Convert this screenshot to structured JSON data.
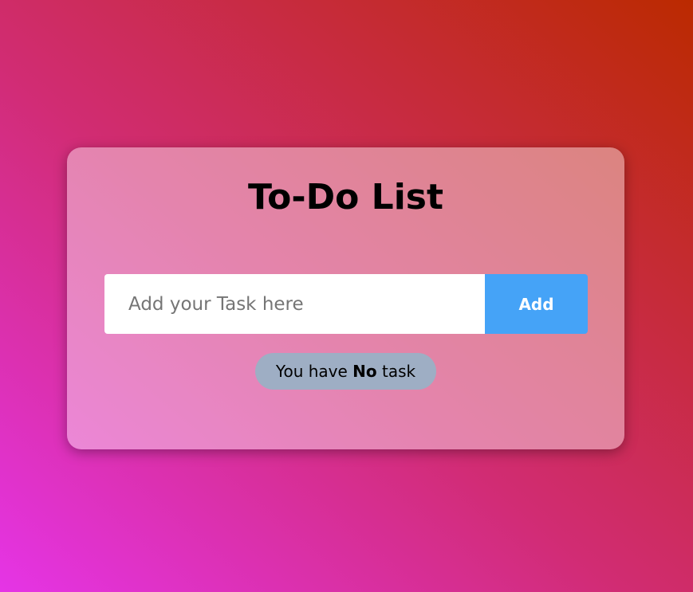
{
  "app": {
    "title": "To-Do List"
  },
  "task_form": {
    "input_value": "",
    "input_placeholder": "Add your Task here",
    "add_label": "Add"
  },
  "status": {
    "prefix": "You have ",
    "count_text": "No",
    "suffix": " task"
  },
  "colors": {
    "background_gradient": [
      "#e534e6",
      "#d12c73",
      "#bb2a00"
    ],
    "add_button": "#45a3f7",
    "status_pill": "#9eaec4",
    "input_background": "#ffffff"
  }
}
